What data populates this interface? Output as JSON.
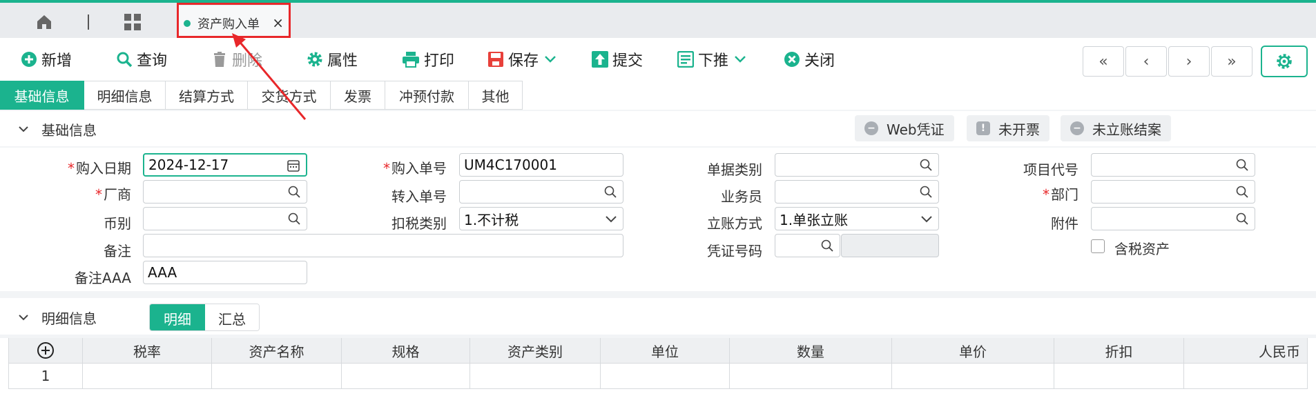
{
  "tabbar": {
    "doc_tab_label": "资产购入单",
    "close_glyph": "×"
  },
  "toolbar": {
    "add": "新增",
    "query": "查询",
    "delete": "删除",
    "properties": "属性",
    "print": "打印",
    "save": "保存",
    "submit": "提交",
    "push_down": "下推",
    "close": "关闭"
  },
  "nav": {
    "first": "«",
    "prev": "‹",
    "next": "›",
    "last": "»"
  },
  "subtabs": [
    "基础信息",
    "明细信息",
    "结算方式",
    "交货方式",
    "发票",
    "冲预付款",
    "其他"
  ],
  "basic_section": {
    "title": "基础信息",
    "status_pills": [
      "Web凭证",
      "未开票",
      "未立账结案"
    ]
  },
  "form": {
    "purchase_date_label": "购入日期",
    "purchase_date_value": "2024-12-17",
    "purchase_no_label": "购入单号",
    "purchase_no_value": "UM4C170001",
    "doc_type_label": "单据类别",
    "project_code_label": "项目代号",
    "vendor_label": "厂商",
    "transfer_no_label": "转入单号",
    "salesman_label": "业务员",
    "dept_label": "部门",
    "currency_label": "币别",
    "tax_type_label": "扣税类别",
    "tax_type_value": "1.不计税",
    "account_method_label": "立账方式",
    "account_method_value": "1.单张立账",
    "attachment_label": "附件",
    "remark_label": "备注",
    "voucher_no_label": "凭证号码",
    "tax_incl_label": "含税资产",
    "remark_aaa_label": "备注AAA",
    "remark_aaa_value": "AAA",
    "required_mark": "*"
  },
  "detail_section": {
    "title": "明细信息",
    "toggle": [
      "明细",
      "汇总"
    ]
  },
  "grid": {
    "columns": [
      "税率",
      "资产名称",
      "规格",
      "资产类别",
      "单位",
      "数量",
      "单价",
      "折扣",
      "人民币"
    ],
    "rows": [
      [
        "1"
      ]
    ]
  },
  "colors": {
    "accent": "#1bb38e",
    "annotation": "#e8272a"
  }
}
